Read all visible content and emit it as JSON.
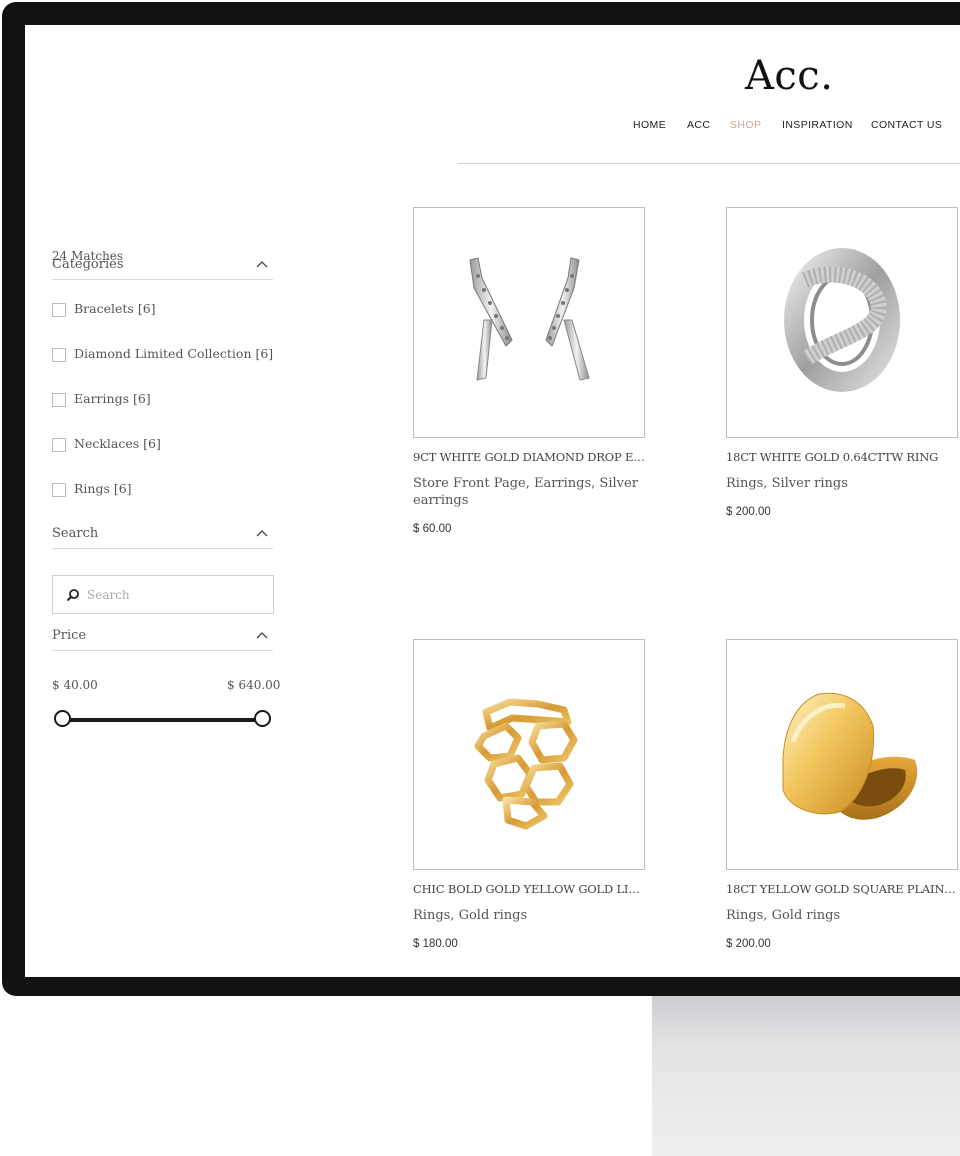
{
  "brand": {
    "logo": "Acc."
  },
  "nav": [
    {
      "label": "HOME",
      "active": false
    },
    {
      "label": "ACC",
      "active": false
    },
    {
      "label": "SHOP",
      "active": true
    },
    {
      "label": "INSPIRATION",
      "active": false
    },
    {
      "label": "CONTACT US",
      "active": false
    }
  ],
  "sidebar": {
    "matches": "24 Matches",
    "categories_title": "Categories",
    "categories": [
      {
        "label": "Bracelets [6]",
        "checked": false
      },
      {
        "label": "Diamond Limited Collection [6]",
        "checked": false
      },
      {
        "label": "Earrings [6]",
        "checked": false
      },
      {
        "label": "Necklaces [6]",
        "checked": false
      },
      {
        "label": "Rings [6]",
        "checked": false
      }
    ],
    "search_title": "Search",
    "search_placeholder": "Search",
    "search_value": "",
    "price_title": "Price",
    "price_min": "$ 40.00",
    "price_max": "$ 640.00"
  },
  "products": [
    {
      "name": "9CT WHITE GOLD DIAMOND DROP EAR...",
      "categories": "Store Front Page, Earrings, Silver earrings",
      "price": "$ 60.00",
      "image_icon": "silver-drop-earrings-image"
    },
    {
      "name": "18CT WHITE GOLD 0.64CTTW RING",
      "categories": "Rings, Silver rings",
      "price": "$ 200.00",
      "image_icon": "white-gold-diamond-ring-image"
    },
    {
      "name": "CHIC BOLD GOLD YELLOW GOLD LINK...",
      "categories": "Rings, Gold rings",
      "price": "$ 180.00",
      "image_icon": "gold-link-ring-image"
    },
    {
      "name": "18CT YELLOW GOLD SQUARE PLAIN SI...",
      "categories": "Rings, Gold rings",
      "price": "$ 200.00",
      "image_icon": "gold-signet-ring-image"
    }
  ],
  "colors": {
    "accent": "#c9a79a",
    "text": "#555555",
    "frame": "#121212",
    "gold": "#e8b54a",
    "silver": "#c8c8c8"
  }
}
